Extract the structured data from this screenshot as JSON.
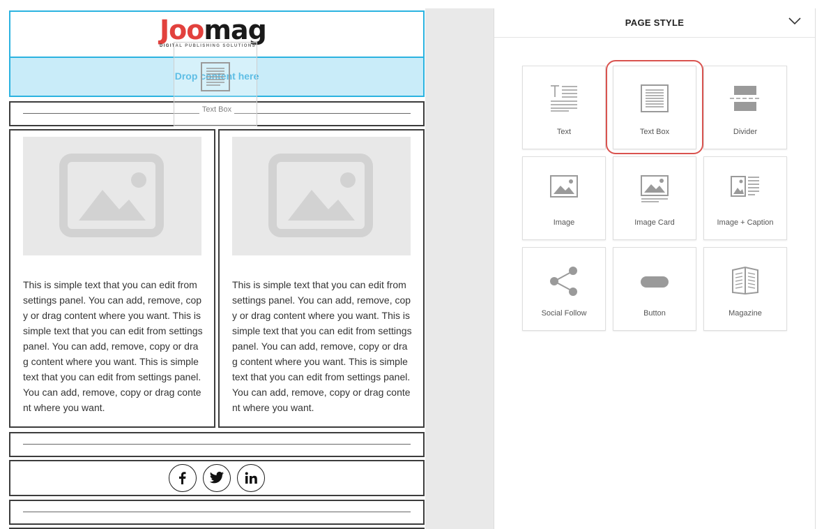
{
  "canvas": {
    "logo": {
      "brand_red": "Joo",
      "brand_dark": "mag",
      "tagline": "DIGITAL PUBLISHING SOLUTIONS"
    },
    "drop_zone_text": "Drop content here",
    "textbox_label": "Text Box",
    "columns": [
      {
        "paragraph": "This is simple text that you can edit from settings panel. You can add, remove, copy or drag content where you want. This is simple text that you can edit from settings panel. You can add, remove, copy or drag content where you want. This is simple text that you can edit from settings panel. You can add, remove, copy or drag content where you want."
      },
      {
        "paragraph": "This is simple text that you can edit from settings panel. You can add, remove, copy or drag content where you want. This is simple text that you can edit from settings panel. You can add, remove, copy or drag content where you want. This is simple text that you can edit from settings panel. You can add, remove, copy or drag content where you want."
      }
    ],
    "social": [
      {
        "glyph": "f",
        "icon": "facebook-icon"
      },
      {
        "glyph": "t",
        "icon": "twitter-icon"
      },
      {
        "glyph": "in",
        "icon": "linkedin-icon"
      }
    ]
  },
  "panel": {
    "title": "PAGE STYLE",
    "tiles": [
      {
        "label": "Text",
        "icon": "text-icon"
      },
      {
        "label": "Text Box",
        "icon": "textbox-icon",
        "highlighted": true
      },
      {
        "label": "Divider",
        "icon": "divider-icon"
      },
      {
        "label": "Image",
        "icon": "image-icon"
      },
      {
        "label": "Image Card",
        "icon": "image-card-icon"
      },
      {
        "label": "Image + Caption",
        "icon": "image-caption-icon"
      },
      {
        "label": "Social Follow",
        "icon": "share-icon"
      },
      {
        "label": "Button",
        "icon": "button-icon"
      },
      {
        "label": "Magazine",
        "icon": "magazine-icon"
      }
    ]
  },
  "colors": {
    "accent_blue": "#2bb3e0",
    "drop_bg": "#c9ecf9",
    "highlight_red": "#d9534f",
    "brand_red": "#e2413d"
  }
}
